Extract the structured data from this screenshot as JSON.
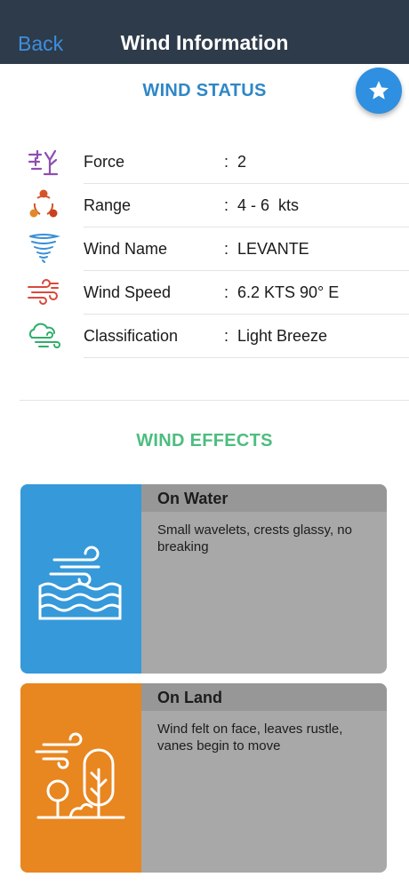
{
  "nav": {
    "back_label": "Back",
    "title": "Wind Information"
  },
  "colors": {
    "navbar": "#2e3b4a",
    "back": "#3d8fe0",
    "status_title": "#2f87c6",
    "effects_title": "#4dbd7f",
    "water_card": "#3699d9",
    "land_card": "#e8861f",
    "card_body": "#a8a8a8"
  },
  "favorite_icon": "star-icon",
  "status": {
    "title": "WIND STATUS",
    "rows": [
      {
        "icon": "beaufort-force-icon",
        "label": "Force",
        "colon": ":",
        "value": "2"
      },
      {
        "icon": "range-cycle-icon",
        "label": "Range",
        "colon": ":",
        "value": "4 - 6  kts"
      },
      {
        "icon": "tornado-icon",
        "label": "Wind Name",
        "colon": ":",
        "value": "LEVANTE"
      },
      {
        "icon": "wind-speed-icon",
        "label": "Wind Speed",
        "colon": ":",
        "value": "6.2 KTS 90° E"
      },
      {
        "icon": "cloud-wind-icon",
        "label": "Classification",
        "colon": ":",
        "value": "Light Breeze"
      }
    ]
  },
  "effects": {
    "title": "WIND EFFECTS",
    "water": {
      "icon": "waves-wind-icon",
      "heading": "On Water",
      "text": "Small wavelets, crests glassy, no breaking"
    },
    "land": {
      "icon": "trees-wind-icon",
      "heading": "On Land",
      "text": "Wind felt on face, leaves rustle, vanes begin to move"
    }
  }
}
